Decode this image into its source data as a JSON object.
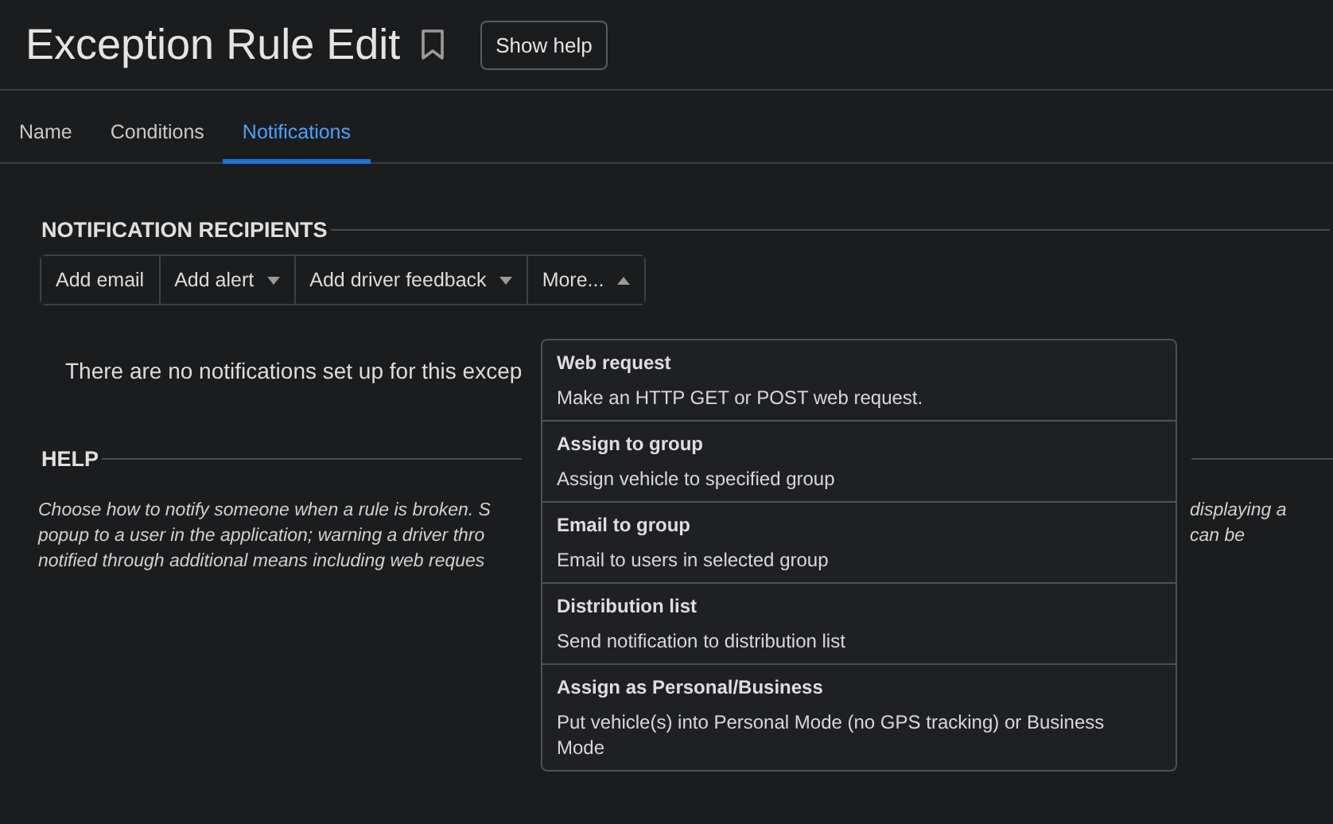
{
  "header": {
    "title": "Exception Rule Edit",
    "bookmarked": false,
    "help_button": "Show help"
  },
  "tabs": [
    {
      "label": "Name",
      "selected": false
    },
    {
      "label": "Conditions",
      "selected": false
    },
    {
      "label": "Notifications",
      "selected": true
    }
  ],
  "recipients": {
    "heading": "NOTIFICATION RECIPIENTS",
    "buttons": [
      {
        "label": "Add email",
        "kind": "plain"
      },
      {
        "label": "Add alert",
        "kind": "dropdown",
        "expanded": false
      },
      {
        "label": "Add driver feedback",
        "kind": "dropdown",
        "expanded": false
      },
      {
        "label": "More...",
        "kind": "dropdown",
        "expanded": true
      }
    ],
    "empty_message": "There are no notifications set up for this excep"
  },
  "help": {
    "heading": "HELP",
    "lines_left": [
      "Choose how to notify someone when a rule is broken. S",
      "popup to a user in the application; warning a driver thro",
      "notified through additional means including web reques"
    ],
    "lines_right": [
      "displaying a",
      "can be"
    ]
  },
  "more_menu": [
    {
      "title": "Web request",
      "description": "Make an HTTP GET or POST web request."
    },
    {
      "title": "Assign to group",
      "description": "Assign vehicle to specified group"
    },
    {
      "title": "Email to group",
      "description": "Email to users in selected group"
    },
    {
      "title": "Distribution list",
      "description": "Send notification to distribution list"
    },
    {
      "title": "Assign as Personal/Business",
      "description": "Put vehicle(s) into Personal Mode (no GPS tracking) or Business Mode"
    }
  ]
}
